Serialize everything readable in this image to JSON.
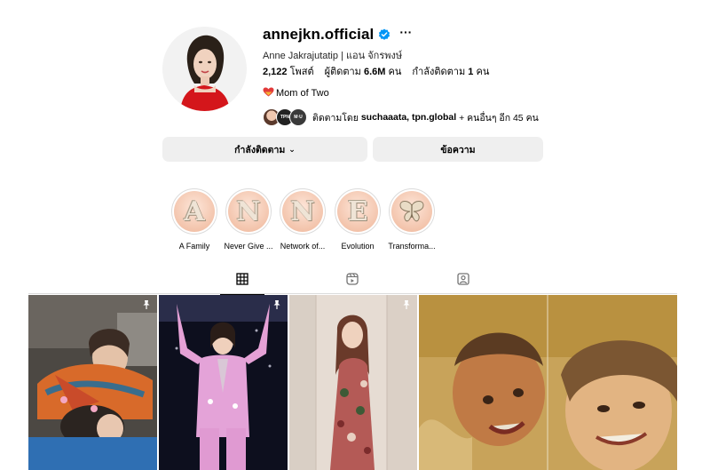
{
  "profile": {
    "username": "annejkn.official",
    "fullname": "Anne Jakrajutatip | แอน จักรพงษ์",
    "posts_count": "2,122",
    "posts_label": "โพสต์",
    "followers_label": "ผู้ติดตาม",
    "followers_count": "6.6M",
    "followers_unit": "คน",
    "following_label": "กำลังติดตาม",
    "following_count": "1",
    "following_unit": "คน",
    "bio": "Mom of Two",
    "followed_prefix": "ติดตามโดย",
    "followed_names": "suchaaata, tpn.global",
    "followed_suffix": "+ คนอื่นๆ อีก 45 คน",
    "more_glyph": "···",
    "mini_avatar_2_text": "TPN",
    "mini_avatar_3_text": "M·U"
  },
  "buttons": {
    "following": "กำลังติดตาม",
    "following_chevron": "⌄",
    "message": "ข้อความ"
  },
  "highlights": [
    {
      "letter": "A",
      "label": "A Family"
    },
    {
      "letter": "N",
      "label": "Never Give ..."
    },
    {
      "letter": "N",
      "label": "Network of..."
    },
    {
      "letter": "E",
      "label": "Evolution"
    },
    {
      "letter": "",
      "label": "Transforma..."
    }
  ],
  "tabs": [
    {
      "name": "posts",
      "icon": "grid-icon",
      "active": true
    },
    {
      "name": "reels",
      "icon": "reels-icon",
      "active": false
    },
    {
      "name": "tagged",
      "icon": "tagged-icon",
      "active": false
    }
  ],
  "posts": [
    {
      "pinned": true,
      "icon": "pin-icon"
    },
    {
      "pinned": true,
      "icon": "pin-icon"
    },
    {
      "pinned": true,
      "icon": "pin-icon"
    },
    {
      "pinned": false
    }
  ],
  "colors": {
    "verified": "#0095f6",
    "button_bg": "#efefef",
    "highlight_bg": "#f3c4ac",
    "divider": "#dbdbdb"
  }
}
